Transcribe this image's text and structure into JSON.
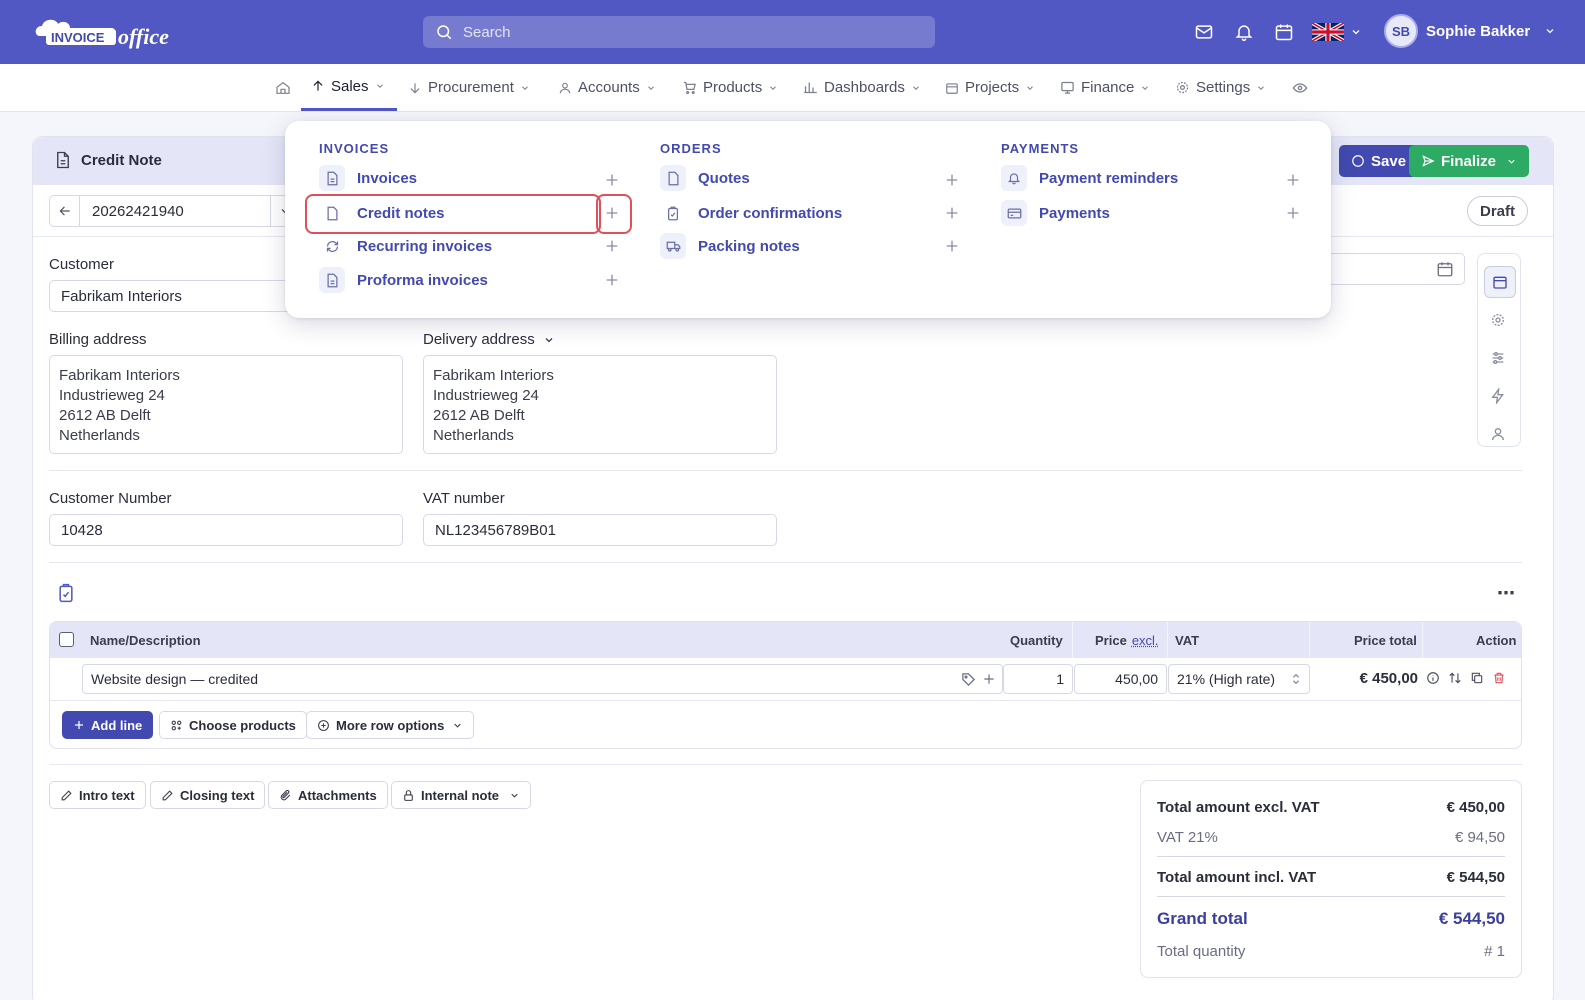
{
  "app": {
    "logo_text": "INVOICEoffice"
  },
  "search": {
    "placeholder": "Search"
  },
  "user": {
    "initials": "SB",
    "name": "Sophie Bakker"
  },
  "nav": {
    "items": [
      {
        "label": "Sales"
      },
      {
        "label": "Procurement"
      },
      {
        "label": "Accounts"
      },
      {
        "label": "Products"
      },
      {
        "label": "Dashboards"
      },
      {
        "label": "Projects"
      },
      {
        "label": "Finance"
      },
      {
        "label": "Settings"
      }
    ],
    "active": "Sales"
  },
  "menu": {
    "invoices": {
      "heading": "INVOICES",
      "items": [
        {
          "label": "Invoices"
        },
        {
          "label": "Credit notes"
        },
        {
          "label": "Recurring invoices"
        },
        {
          "label": "Proforma invoices"
        }
      ]
    },
    "orders": {
      "heading": "ORDERS",
      "items": [
        {
          "label": "Quotes"
        },
        {
          "label": "Order confirmations"
        },
        {
          "label": "Packing notes"
        }
      ]
    },
    "payments": {
      "heading": "PAYMENTS",
      "items": [
        {
          "label": "Payment reminders"
        },
        {
          "label": "Payments"
        }
      ]
    }
  },
  "doc": {
    "title": "Credit Note",
    "number": "20262421940",
    "status": "Draft",
    "save_label": "Save",
    "finalize_label": "Finalize"
  },
  "form": {
    "customer_label": "Customer",
    "customer_value": "Fabrikam Interiors",
    "billing_label": "Billing address",
    "billing_lines": [
      "Fabrikam Interiors",
      "Industrieweg 24",
      "2612 AB Delft",
      "Netherlands"
    ],
    "delivery_label": "Delivery address",
    "delivery_lines": [
      "Fabrikam Interiors",
      "Industrieweg 24",
      "2612 AB Delft",
      "Netherlands"
    ],
    "customer_number_label": "Customer Number",
    "customer_number_value": "10428",
    "vat_label": "VAT number",
    "vat_value": "NL123456789B01"
  },
  "lines": {
    "headers": {
      "name": "Name/Description",
      "quantity": "Quantity",
      "price": "Price",
      "price_suffix": "excl.",
      "vat": "VAT",
      "price_total": "Price total",
      "action": "Action"
    },
    "rows": [
      {
        "description": "Website design — credited",
        "quantity": "1",
        "price": "450,00",
        "vat": "21% (High rate)",
        "total": "€ 450,00"
      }
    ],
    "add_line": "Add line",
    "choose_products": "Choose products",
    "more_row_options": "More row options"
  },
  "attachments": {
    "intro": "Intro text",
    "closing": "Closing text",
    "attachments": "Attachments",
    "internal_note": "Internal note"
  },
  "totals": {
    "excl_label": "Total amount excl. VAT",
    "excl_value": "€ 450,00",
    "vat_label": "VAT 21%",
    "vat_value": "€ 94,50",
    "incl_label": "Total amount incl. VAT",
    "incl_value": "€ 544,50",
    "grand_label": "Grand total",
    "grand_value": "€ 544,50",
    "qty_label": "Total quantity",
    "qty_value": "# 1"
  },
  "colors": {
    "brand": "#5157c3",
    "accent": "#4249b0",
    "success": "#2daa63",
    "highlight": "#e0505a"
  }
}
